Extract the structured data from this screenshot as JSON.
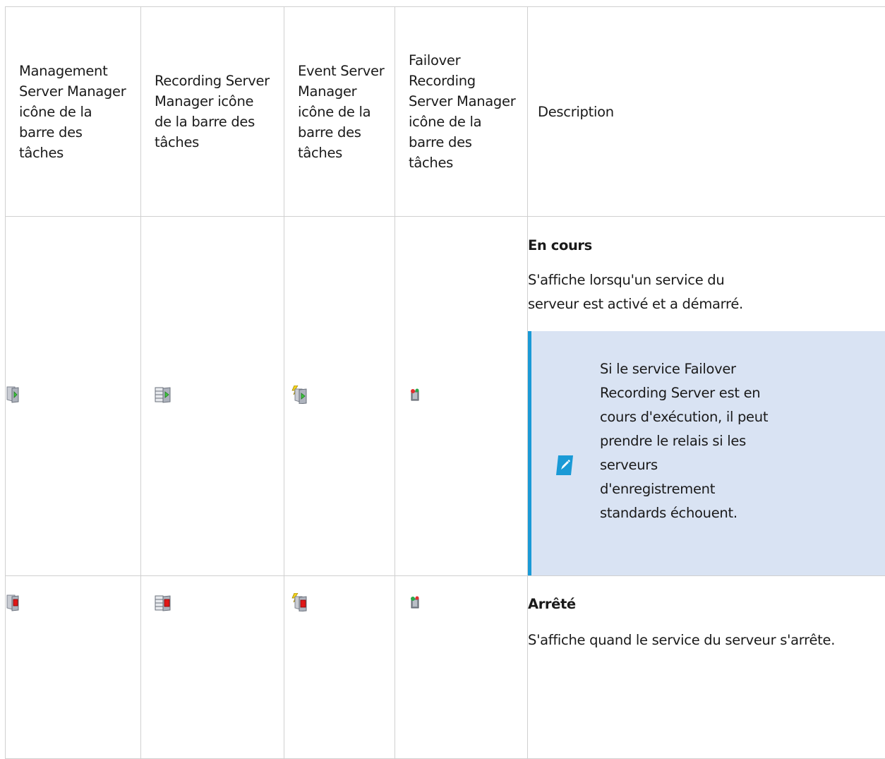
{
  "headers": {
    "management": "Management Server Manager icône de la barre des tâches",
    "recording": "Recording Server Manager icône de la barre des tâches",
    "event": "Event Server Manager icône de la barre des tâches",
    "failover": "Failover Recording Server Manager icône de la barre des tâches",
    "description": "Description"
  },
  "rows": [
    {
      "state": "running",
      "title": "En cours",
      "text": "S'affiche lorsqu'un service du serveur est activé et a démarré.",
      "note": "Si le service Failover Recording Server est en cours d'exécution, il peut prendre le relais si les serveurs d'enregistrement standards échouent."
    },
    {
      "state": "stopped",
      "title": "Arrêté",
      "text": "S'affiche quand le service du serveur s'arrête."
    }
  ],
  "icons": {
    "management": "management-server-tray-icon",
    "recording": "recording-server-tray-icon",
    "event": "event-server-tray-icon",
    "failover": "failover-server-tray-icon",
    "note": "pencil-note-icon"
  },
  "colors": {
    "running": "#3cc83c",
    "stopped": "#e01818",
    "note_bg": "#d9e3f3",
    "note_accent": "#1a9ad6"
  }
}
